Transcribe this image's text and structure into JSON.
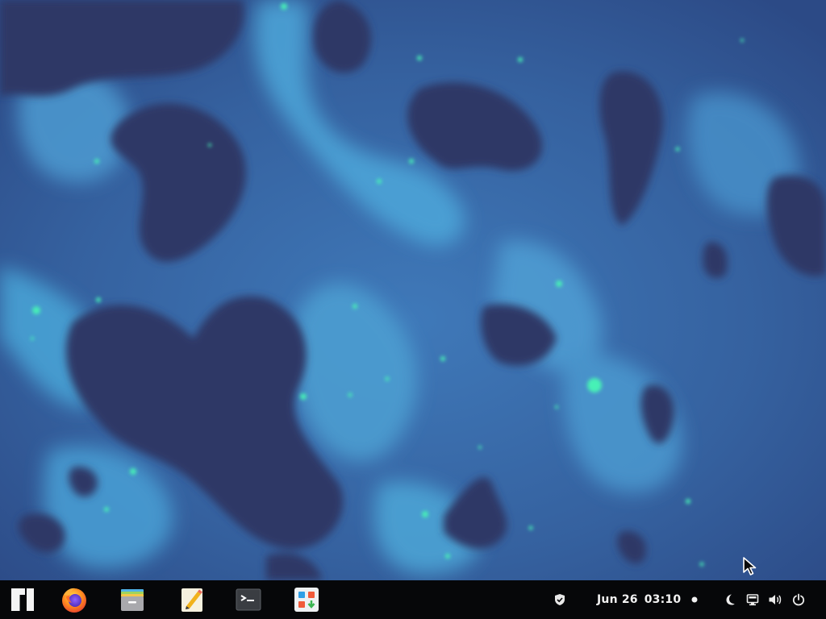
{
  "taskbar": {
    "launcher": {
      "icon": "manjaro-logo-icon"
    },
    "apps": [
      {
        "name": "firefox",
        "icon": "firefox-icon"
      },
      {
        "name": "files",
        "icon": "file-manager-icon"
      },
      {
        "name": "text-editor",
        "icon": "text-editor-icon"
      },
      {
        "name": "terminal",
        "icon": "terminal-icon"
      },
      {
        "name": "software",
        "icon": "software-center-icon"
      }
    ],
    "tray": {
      "clock_date": "Jun 26",
      "clock_time": "03:10",
      "icons": [
        "shield-icon",
        "notification-dot-icon",
        "night-light-icon",
        "network-icon",
        "volume-icon",
        "power-icon"
      ]
    }
  },
  "colors": {
    "taskbar_bg": "#060709",
    "wallpaper_dark": "#2b3a6b",
    "wallpaper_mid": "#3b6fb0",
    "wallpaper_light": "#4aa3d6",
    "glow": "#3cf0b0"
  }
}
